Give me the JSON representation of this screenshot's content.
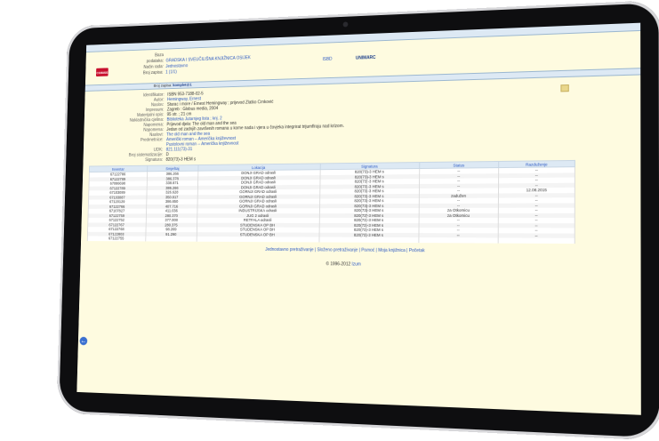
{
  "header": {
    "logo_text": "COBISS",
    "info": [
      {
        "key": "Baza podataka",
        "value": "GRADSKA I SVEUČILIŠNA KNJIŽNICA OSIJEK"
      },
      {
        "key": "Način rada",
        "value": "Jednostavno"
      },
      {
        "key": "Broj zapisa",
        "value": "1 (1/1)"
      }
    ],
    "tabs": [
      {
        "label": "ISBD",
        "active": false
      },
      {
        "label": "UNIMARC",
        "active": true
      }
    ]
  },
  "bar": {
    "label": "Broj zapisa:",
    "value": "komplet@1"
  },
  "record": [
    {
      "key": "Identifikator",
      "value": "ISBN 953-7188-02-5",
      "link": false
    },
    {
      "key": "Autor",
      "value": "Hemingway, Ernest",
      "link": true
    },
    {
      "key": "Naslov",
      "value": "Starac i more / Ernest Hemingway ; prijevod Zlatko Crnković",
      "link": false
    },
    {
      "key": "Impresum",
      "value": "Zagreb : Globus media, 2004",
      "link": false
    },
    {
      "key": "Materijalni opis",
      "value": "95 str. ; 21 cm",
      "link": false
    },
    {
      "key": "Nakladnička cjelina",
      "value": "Biblioteka Jutarnjeg lista ; knj. 2",
      "link": true
    },
    {
      "key": "Napomena",
      "value": "Prijevod djela: The old man and the sea",
      "link": false
    },
    {
      "key": "Napomena",
      "value": "Jedan od zadnjih završenih romana u kome nada i vjera u čovjeka integrirat trijumfiraju nad krizom.",
      "link": false
    },
    {
      "key": "Naslovi",
      "value": "The old man and the sea",
      "link": true
    },
    {
      "key": "Predmetnice",
      "value": "Američki roman -- Američka književnost",
      "link": true
    },
    {
      "key": "",
      "value": "Pustolovni roman -- Američka književnost",
      "link": true
    },
    {
      "key": "UDK",
      "value": "821.111(73)-31",
      "link": true
    },
    {
      "key": "Broj sistematizacije",
      "value": "D",
      "link": false
    },
    {
      "key": "Signatura",
      "value": "820(73)-3 HEM s",
      "link": false
    }
  ],
  "table": {
    "headers": [
      "Inventar",
      "Smještaj",
      "Lokacija",
      "Signatura",
      "Status",
      "Razduženje"
    ],
    "rows": [
      [
        "67122786",
        "386.266",
        "DONJI GRAD odrasli",
        "820(73)-3 HEM s",
        "--",
        "--"
      ],
      [
        "67122789",
        "386.378",
        "DONJI GRAD odrasli",
        "820(73)-3 HEM s",
        "--",
        "--"
      ],
      [
        "67086698",
        "338.871",
        "DONJI GRAD odrasli",
        "820(73)-3 HEM s",
        "--",
        "--"
      ],
      [
        "67122789",
        "386.266",
        "DONJI GRAD odrasli",
        "820(73)-3 HEM s",
        "--",
        "--"
      ],
      [
        "67103089",
        "326.628",
        "GORNJI GRAD odrasli",
        "820(73)-3 HEM s",
        "--",
        "12.08.2015"
      ],
      [
        "67103087",
        "350.917",
        "GORNJI GRAD odrasli",
        "820(73)-3 HEM s",
        "zadužen",
        "--"
      ],
      [
        "67120129",
        "386.850",
        "GORNJI GRAD odrasli",
        "820(73)-3 HEM s",
        "--",
        "--"
      ],
      [
        "67122766",
        "407.716",
        "GORNJI GRAD odrasli",
        "820(73)-3 HEM s",
        "--",
        "--"
      ],
      [
        "67107827",
        "411.036",
        "INDUSTRIJSKA odrasli",
        "820(73)-3 HEM s",
        "za Otkomicu",
        "--"
      ],
      [
        "67122759",
        "280.370",
        "JUG 2 odrasli",
        "820(73)-3 HEM s",
        "za Otkomicu",
        "--"
      ],
      [
        "67122752",
        "377.008",
        "RETFALA odrasli",
        "820(73)-3 HEM s",
        "--",
        "--"
      ],
      [
        "67122767",
        "280.375",
        "STUDENSKA OP BH",
        "820(73)-3 HEM s",
        "--",
        "--"
      ],
      [
        "67122768",
        "98.269",
        "STUDENSKA OP BH",
        "820(73)-3 HEM s",
        "--",
        "--"
      ],
      [
        "67122803",
        "91.290",
        "STUDENSKA OP BH",
        "820(73)-3 HEM s",
        "--",
        "--"
      ],
      [
        "67122755",
        "",
        "",
        "",
        "",
        ""
      ]
    ]
  },
  "footer": {
    "links": "Jednostavno pretraživanje | Složeno pretraživanje | Pomoć | Moja knjižnica | Početak",
    "copyright_prefix": "© 1996-2012",
    "copyright_link": "Izum"
  }
}
